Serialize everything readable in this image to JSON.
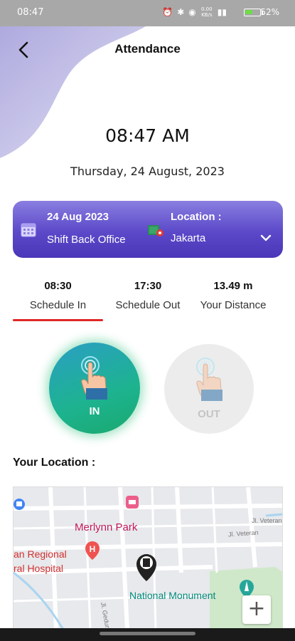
{
  "status_bar": {
    "time": "08:47",
    "icons": [
      "alarm-icon",
      "bluetooth-icon",
      "location-icon",
      "data-speed-icon",
      "signal-icon",
      "battery-icon"
    ],
    "data_speed": "0.00 KB/s",
    "battery_pct": "52%",
    "battery_level": 0.52
  },
  "header": {
    "title": "Attendance",
    "back_icon": "back-arrow-icon"
  },
  "clock": {
    "time": "08:47 AM",
    "date": "Thursday, 24 August, 2023"
  },
  "shift_card": {
    "date": "24 Aug 2023",
    "shift": "Shift Back Office",
    "location_label": "Location :",
    "location": "Jakarta",
    "colors": {
      "top": "#8a7ee0",
      "bottom": "#4a36b8"
    }
  },
  "stats": [
    {
      "value": "08:30",
      "label": "Schedule In"
    },
    {
      "value": "17:30",
      "label": "Schedule Out"
    },
    {
      "value": "13.49 m",
      "label": "Your Distance"
    }
  ],
  "buttons": {
    "in_label": "IN",
    "out_label": "OUT",
    "in_color": "#1db38f",
    "out_color": "#ececec"
  },
  "location_heading": "Your Location :",
  "map": {
    "labels": {
      "park": "Merlynn Park",
      "hospital_line1": "an Regional",
      "hospital_line2": "ral Hospital",
      "monument": "National Monument",
      "street1": "Jl. Veteran",
      "street2": "Jl. Veteran",
      "street3": "Jl. Gedung"
    },
    "zoom_label": "+",
    "colors": {
      "label_pink": "#c2185b",
      "label_teal": "#00897b",
      "label_red": "#d32f2f",
      "park_green": "#cfe8c9"
    }
  }
}
